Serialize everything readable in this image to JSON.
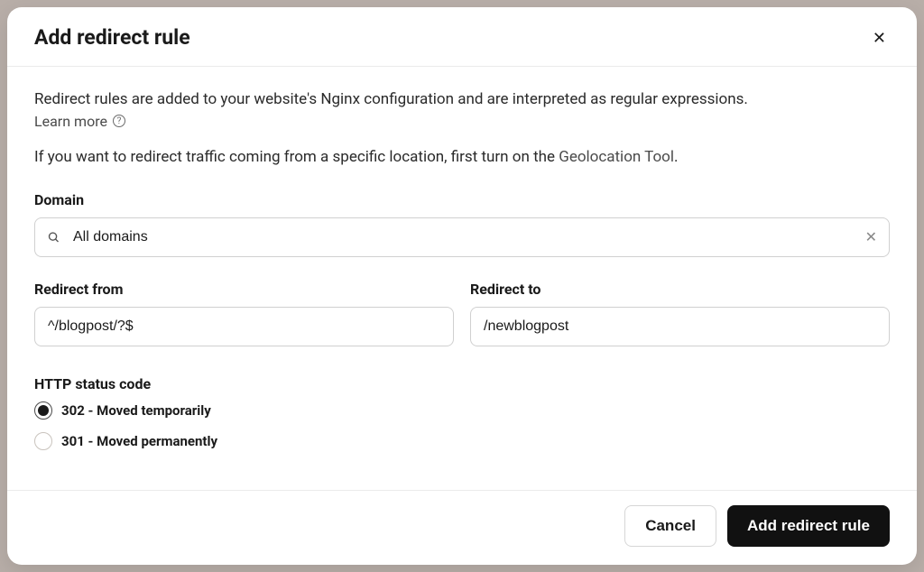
{
  "modal": {
    "title": "Add redirect rule",
    "description": "Redirect rules are added to your website's Nginx configuration and are interpreted as regular expressions.",
    "learn_more": "Learn more",
    "geo_prefix": "If you want to redirect traffic coming from a specific location, first turn on the ",
    "geo_link": "Geolocation Tool",
    "geo_suffix": "."
  },
  "fields": {
    "domain": {
      "label": "Domain",
      "value": "All domains"
    },
    "redirect_from": {
      "label": "Redirect from",
      "value": "^/blogpost/?$"
    },
    "redirect_to": {
      "label": "Redirect to",
      "value": "/newblogpost"
    },
    "status_code": {
      "label": "HTTP status code",
      "option_302": "302 - Moved temporarily",
      "option_301": "301 - Moved permanently",
      "selected": "302"
    }
  },
  "footer": {
    "cancel": "Cancel",
    "submit": "Add redirect rule"
  }
}
